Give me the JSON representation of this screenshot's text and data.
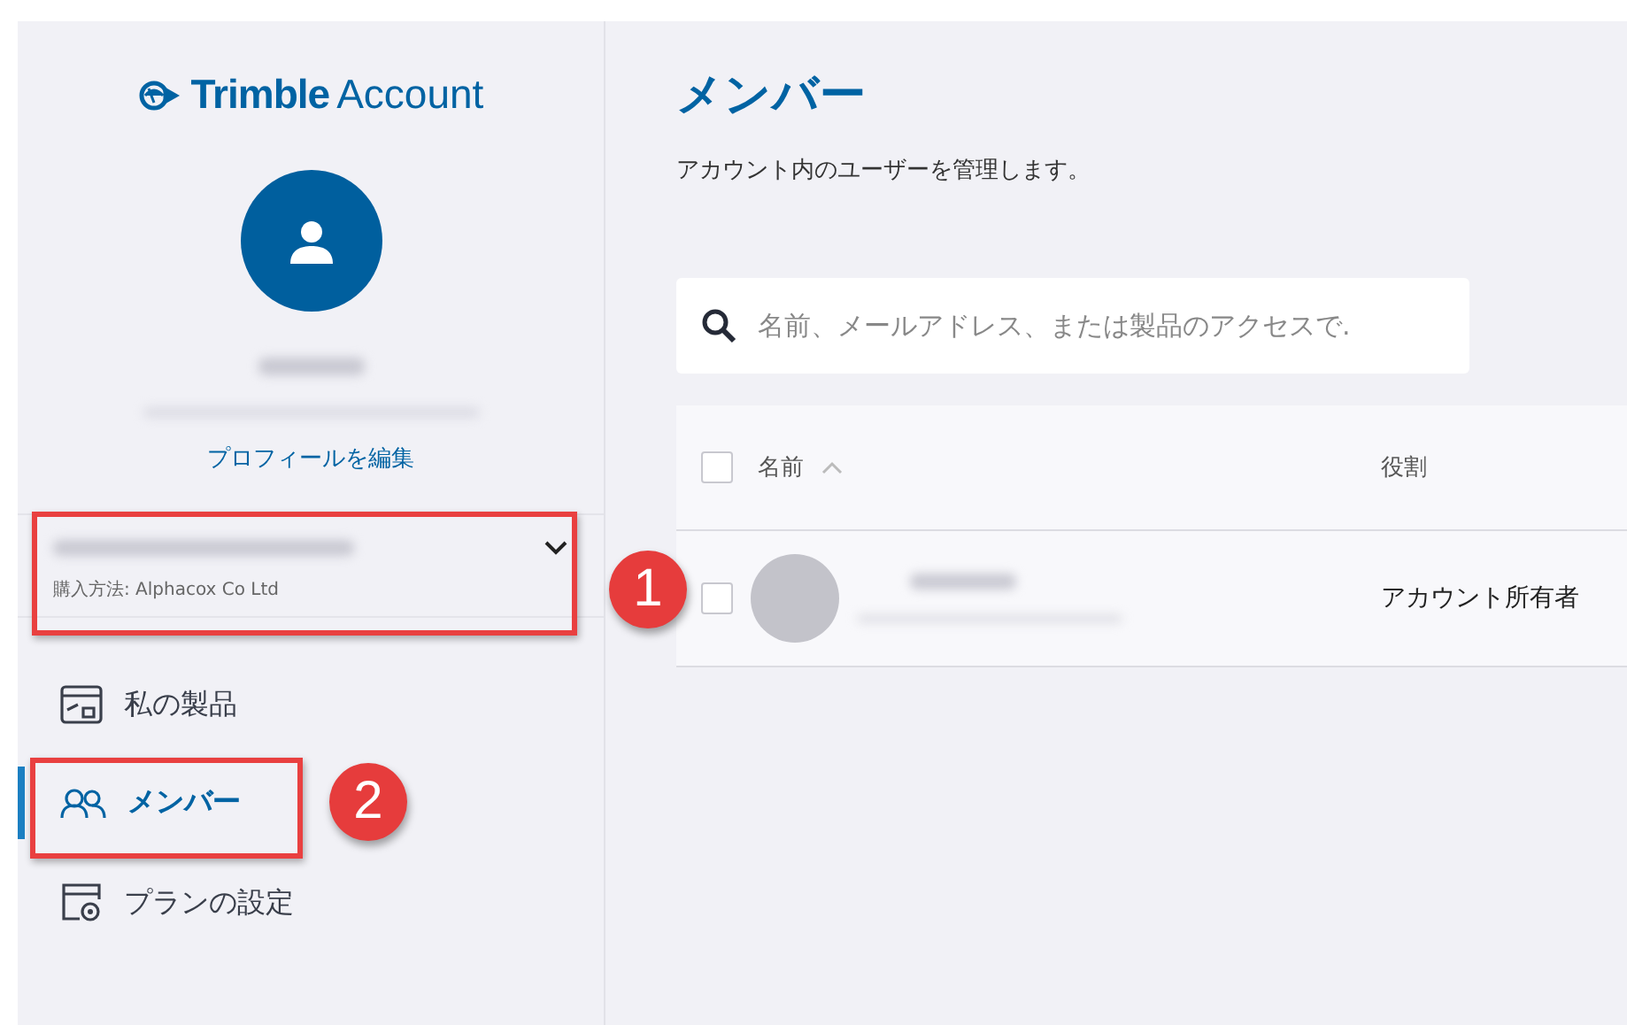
{
  "app": {
    "logo_bold": "Trimble",
    "logo_light": "Account"
  },
  "profile": {
    "edit_link": "プロフィールを編集"
  },
  "account_selector": {
    "purchase_via": "購入方法: Alphacox Co Ltd",
    "annotation": "1"
  },
  "nav": [
    {
      "label": "私の製品",
      "kind": "products",
      "selected": false
    },
    {
      "label": "メンバー",
      "kind": "members",
      "selected": true,
      "annotation": "2"
    },
    {
      "label": "プランの設定",
      "kind": "settings",
      "selected": false
    }
  ],
  "page": {
    "title": "メンバー",
    "subtitle": "アカウント内のユーザーを管理します。"
  },
  "search": {
    "placeholder": "名前、メールアドレス、または製品のアクセスで."
  },
  "table": {
    "header_checked": false,
    "columns": [
      {
        "label": "名前",
        "sorted": true
      },
      {
        "label": "役割"
      }
    ],
    "rows": [
      {
        "checked": false,
        "role": "アカウント所有者"
      }
    ]
  }
}
